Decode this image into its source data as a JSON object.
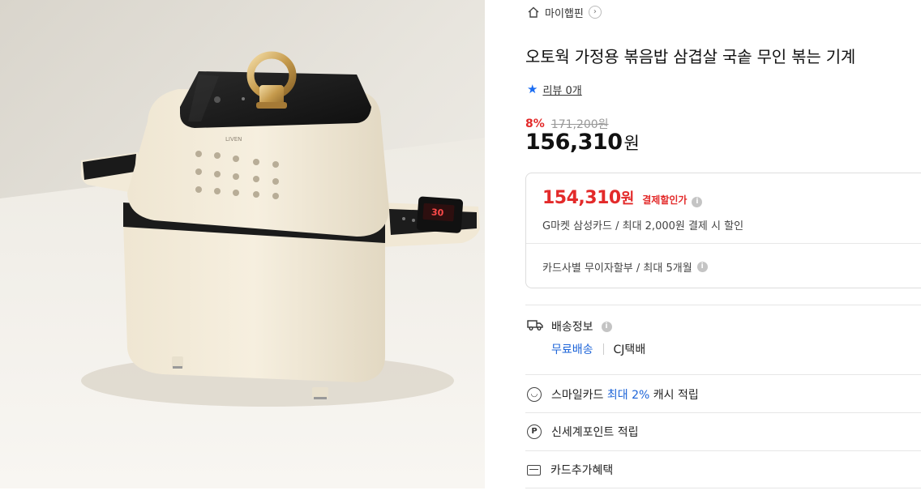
{
  "shop": {
    "name": "마이햅핀",
    "home_icon": "home-icon",
    "chevron": "›"
  },
  "product": {
    "title": "오토웍 가정용 볶음밥 삼겹살 국솥 무인 볶는 기계",
    "image_brand": "LIVEN"
  },
  "reviews": {
    "label": "리뷰 0개",
    "icon": "star-icon",
    "icon_color": "#1a6cf2"
  },
  "price": {
    "discount_rate": "8%",
    "original": "171,200원",
    "sale_number": "156,310",
    "unit": "원"
  },
  "coupon": {
    "price_number": "154,310",
    "unit": "원",
    "tag": "결제할인가",
    "card_note": "G마켓 삼성카드 / 최대 2,000원 결제 시 할인",
    "installment": "카드사별 무이자할부 / 최대 5개월",
    "accent_color": "#e32a2a"
  },
  "shipping": {
    "label": "배송정보",
    "free": "무료배송",
    "carrier": "CJ택배"
  },
  "benefits": {
    "smile_pre": "스마일카드",
    "smile_highlight": "최대 2%",
    "smile_post": "캐시 적립",
    "shinsegae": "신세계포인트 적립",
    "card_extra": "카드추가혜택"
  },
  "appliance_display": {
    "time": "30"
  }
}
